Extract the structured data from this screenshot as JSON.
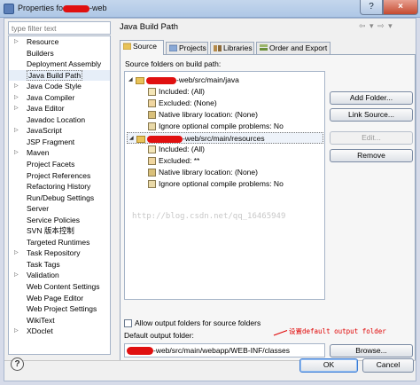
{
  "window": {
    "title_prefix": "Properties fo",
    "title_suffix": "-web",
    "help_glyph": "?",
    "close_glyph": "×"
  },
  "filter": {
    "placeholder": "type filter text"
  },
  "nav": {
    "items": [
      {
        "label": "Resource",
        "expandable": true
      },
      {
        "label": "Builders",
        "expandable": false
      },
      {
        "label": "Deployment Assembly",
        "expandable": false
      },
      {
        "label": "Java Build Path",
        "expandable": false,
        "selected": true
      },
      {
        "label": "Java Code Style",
        "expandable": true
      },
      {
        "label": "Java Compiler",
        "expandable": true
      },
      {
        "label": "Java Editor",
        "expandable": true
      },
      {
        "label": "Javadoc Location",
        "expandable": false
      },
      {
        "label": "JavaScript",
        "expandable": true
      },
      {
        "label": "JSP Fragment",
        "expandable": false
      },
      {
        "label": "Maven",
        "expandable": true
      },
      {
        "label": "Project Facets",
        "expandable": false
      },
      {
        "label": "Project References",
        "expandable": false
      },
      {
        "label": "Refactoring History",
        "expandable": false
      },
      {
        "label": "Run/Debug Settings",
        "expandable": false
      },
      {
        "label": "Server",
        "expandable": false
      },
      {
        "label": "Service Policies",
        "expandable": false
      },
      {
        "label": "SVN 版本控制",
        "expandable": false
      },
      {
        "label": "Targeted Runtimes",
        "expandable": false
      },
      {
        "label": "Task Repository",
        "expandable": true
      },
      {
        "label": "Task Tags",
        "expandable": false
      },
      {
        "label": "Validation",
        "expandable": true
      },
      {
        "label": "Web Content Settings",
        "expandable": false
      },
      {
        "label": "Web Page Editor",
        "expandable": false
      },
      {
        "label": "Web Project Settings",
        "expandable": false
      },
      {
        "label": "WikiText",
        "expandable": false
      },
      {
        "label": "XDoclet",
        "expandable": true
      }
    ]
  },
  "page": {
    "title": "Java Build Path",
    "nav_arrows": "⇦ ▾ ⇨ ▾",
    "tabs": [
      {
        "label": "Source",
        "active": true
      },
      {
        "label": "Projects",
        "active": false
      },
      {
        "label": "Libraries",
        "active": false
      },
      {
        "label": "Order and Export",
        "active": false
      }
    ],
    "source_label": "Source folders on build path:",
    "tree": {
      "folder1": {
        "path": "-web/src/main/java",
        "children": [
          "Included: (All)",
          "Excluded: (None)",
          "Native library location: (None)",
          "Ignore optional compile problems: No"
        ]
      },
      "folder2": {
        "path": "-web/src/main/resources",
        "children": [
          "Included: (All)",
          "Excluded: **",
          "Native library location: (None)",
          "Ignore optional compile problems: No"
        ]
      }
    },
    "watermark": "http://blog.csdn.net/qq_16465949",
    "buttons": {
      "add_folder": "Add Folder...",
      "link_source": "Link Source...",
      "edit": "Edit...",
      "remove": "Remove",
      "browse": "Browse..."
    },
    "allow_output_label": "Allow output folders for source folders",
    "annotation": "设置default output folder",
    "output_label": "Default output folder:",
    "output_value": "-web/src/main/webapp/WEB-INF/classes"
  },
  "footer": {
    "help_glyph": "?",
    "ok_label": "OK",
    "cancel_label": "Cancel"
  },
  "colors": {
    "redaction": "#e01010",
    "annotation": "#e00000",
    "focus_blue": "#3a7bd5"
  }
}
